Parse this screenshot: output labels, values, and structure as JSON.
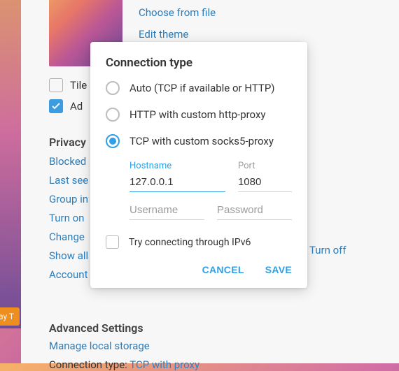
{
  "bg": {
    "theme_thumb_alt": "theme-preview",
    "choose_from_file": "Choose from file",
    "edit_theme": "Edit theme",
    "tile_label": "Tile",
    "ad_label": "Ad",
    "snippet": "ay T"
  },
  "privacy": {
    "heading": "Privacy",
    "blocked": "Blocked",
    "last_seen": "Last see",
    "groups": "Group in",
    "two_step": "Turn on",
    "change": "Change",
    "show_all": "Show all",
    "account": "Account",
    "turn_off": "Turn off"
  },
  "advanced": {
    "heading": "Advanced Settings",
    "manage_local": "Manage local storage",
    "conn_label": "Connection type:",
    "conn_value": "TCP with proxy"
  },
  "modal": {
    "title": "Connection type",
    "opt_auto": "Auto (TCP if available or HTTP)",
    "opt_http": "HTTP with custom http-proxy",
    "opt_socks": "TCP with custom socks5-proxy",
    "hostname_label": "Hostname",
    "hostname_value": "127.0.0.1",
    "port_label": "Port",
    "port_value": "1080",
    "username_ph": "Username",
    "password_ph": "Password",
    "ipv6_label": "Try connecting through IPv6",
    "cancel": "CANCEL",
    "save": "SAVE"
  }
}
